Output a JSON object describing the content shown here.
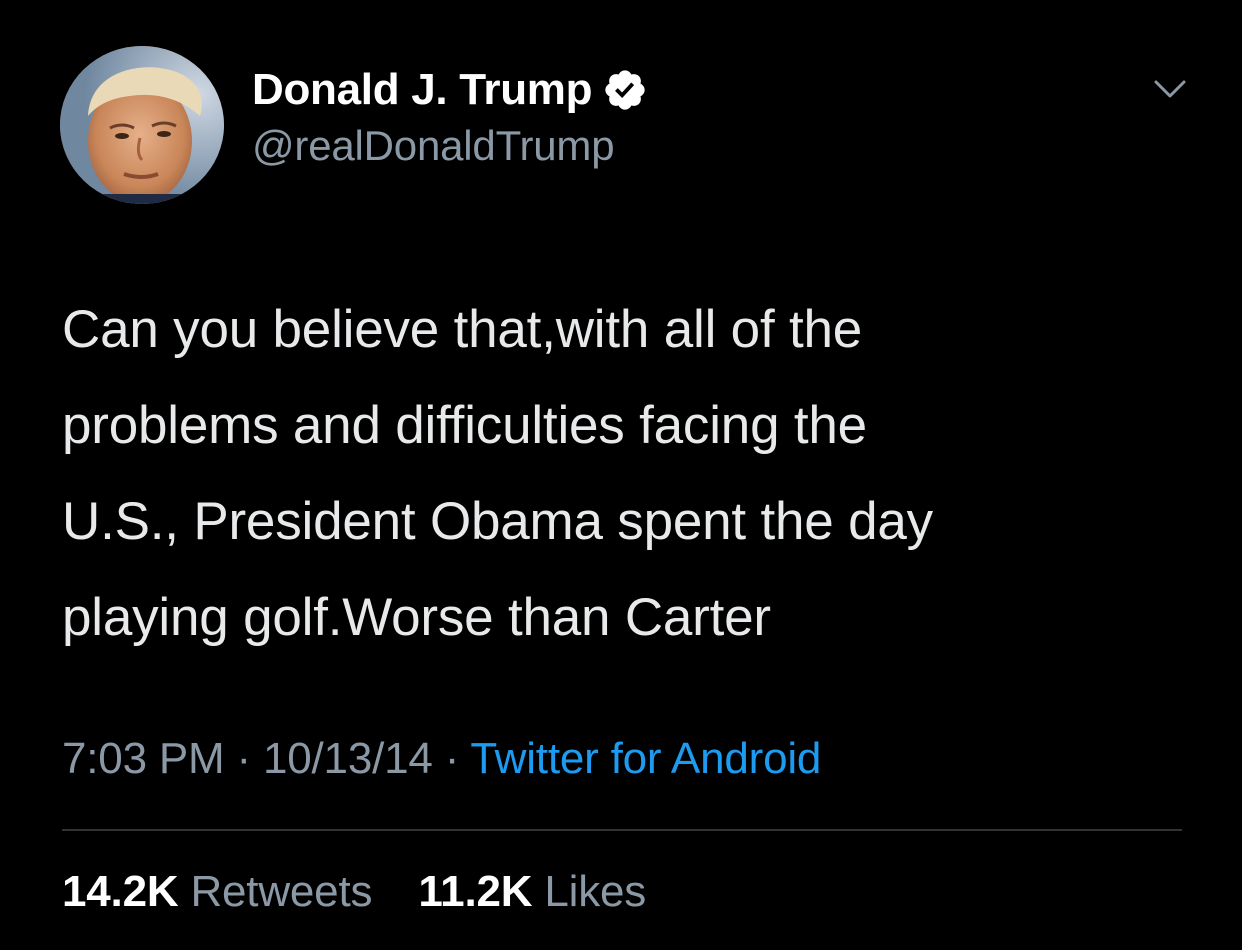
{
  "tweet": {
    "author": {
      "display_name": "Donald J. Trump",
      "handle": "@realDonaldTrump",
      "verified": true,
      "avatar_icon": "profile-photo"
    },
    "text_lines": [
      "Can you believe that,with all of the",
      "problems and difficulties facing the",
      "U.S., President Obama spent the day",
      "playing golf.Worse than Carter"
    ],
    "meta": {
      "time": "7:03 PM",
      "separator": "·",
      "date": "10/13/14",
      "source": "Twitter for Android"
    },
    "stats": {
      "retweets_count": "14.2K",
      "retweets_label": "Retweets",
      "likes_count": "11.2K",
      "likes_label": "Likes"
    }
  },
  "colors": {
    "background": "#000000",
    "text_primary": "#e7e9ea",
    "text_secondary": "#8b98a5",
    "link": "#1d9bf0",
    "divider": "#2f3336"
  }
}
